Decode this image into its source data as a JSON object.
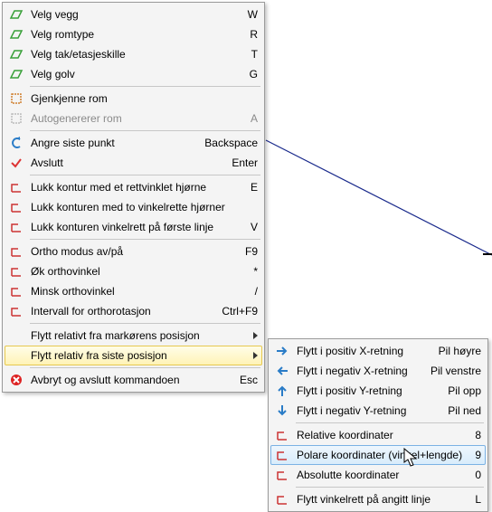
{
  "main_menu": {
    "items": [
      {
        "id": "velg-vegg",
        "label": "Velg vegg",
        "shortcut": "W",
        "icon": "wall",
        "interactable": true
      },
      {
        "id": "velg-romtype",
        "label": "Velg romtype",
        "shortcut": "R",
        "icon": "roomtype",
        "interactable": true
      },
      {
        "id": "velg-tak",
        "label": "Velg tak/etasjeskille",
        "shortcut": "T",
        "icon": "ceiling",
        "interactable": true
      },
      {
        "id": "velg-golv",
        "label": "Velg golv",
        "shortcut": "G",
        "icon": "floor",
        "interactable": true
      },
      {
        "sep": true
      },
      {
        "id": "gjenkjenne-rom",
        "label": "Gjenkjenne rom",
        "shortcut": "",
        "icon": "recognize",
        "interactable": true
      },
      {
        "id": "autogen-rom",
        "label": "Autogenererer rom",
        "shortcut": "A",
        "icon": "autogen",
        "interactable": false,
        "disabled": true
      },
      {
        "sep": true
      },
      {
        "id": "angre-punkt",
        "label": "Angre siste punkt",
        "shortcut": "Backspace",
        "icon": "undo",
        "interactable": true
      },
      {
        "id": "avslutt",
        "label": "Avslutt",
        "shortcut": "Enter",
        "icon": "finish",
        "interactable": true
      },
      {
        "sep": true
      },
      {
        "id": "lukk-rett",
        "label": "Lukk kontur med et rettvinklet hjørne",
        "shortcut": "E",
        "icon": "close-right",
        "interactable": true
      },
      {
        "id": "lukk-to",
        "label": "Lukk konturen med to vinkelrette hjørner",
        "shortcut": "",
        "icon": "close-two",
        "interactable": true
      },
      {
        "id": "lukk-forste",
        "label": "Lukk konturen vinkelrett på første linje",
        "shortcut": "V",
        "icon": "close-first",
        "interactable": true
      },
      {
        "sep": true
      },
      {
        "id": "ortho",
        "label": "Ortho modus av/på",
        "shortcut": "F9",
        "icon": "ortho",
        "interactable": true
      },
      {
        "id": "ok-ortho",
        "label": "Øk orthovinkel",
        "shortcut": "*",
        "icon": "inc-angle",
        "interactable": true
      },
      {
        "id": "minsk-ortho",
        "label": "Minsk orthovinkel",
        "shortcut": "/",
        "icon": "dec-angle",
        "interactable": true
      },
      {
        "id": "intervall",
        "label": "Intervall for orthorotasjon",
        "shortcut": "Ctrl+F9",
        "icon": "interval",
        "interactable": true
      },
      {
        "sep": true
      },
      {
        "id": "flytt-markor",
        "label": "Flytt relativt fra markørens posisjon",
        "shortcut": "",
        "icon": "",
        "submenu": true,
        "interactable": true
      },
      {
        "id": "flytt-siste",
        "label": "Flytt relativ fra siste posisjon",
        "shortcut": "",
        "icon": "",
        "submenu": true,
        "interactable": true,
        "highlight": "main"
      },
      {
        "sep": true
      },
      {
        "id": "avbryt",
        "label": "Avbryt og avslutt kommandoen",
        "shortcut": "Esc",
        "icon": "cancel",
        "interactable": true
      }
    ]
  },
  "sub_menu": {
    "items": [
      {
        "id": "pos-x",
        "label": "Flytt i positiv X-retning",
        "shortcut": "Pil høyre",
        "icon": "arrow-right",
        "interactable": true
      },
      {
        "id": "neg-x",
        "label": "Flytt i negativ X-retning",
        "shortcut": "Pil venstre",
        "icon": "arrow-left",
        "interactable": true
      },
      {
        "id": "pos-y",
        "label": "Flytt i positiv Y-retning",
        "shortcut": "Pil opp",
        "icon": "arrow-up",
        "interactable": true
      },
      {
        "id": "neg-y",
        "label": "Flytt i negativ Y-retning",
        "shortcut": "Pil ned",
        "icon": "arrow-down",
        "interactable": true
      },
      {
        "sep": true
      },
      {
        "id": "rel-koord",
        "label": "Relative koordinater",
        "shortcut": "8",
        "icon": "rel",
        "interactable": true
      },
      {
        "id": "polar-koord",
        "label": "Polare koordinater (vinkel+lengde)",
        "shortcut": "9",
        "icon": "polar",
        "interactable": true,
        "highlight": "sub"
      },
      {
        "id": "abs-koord",
        "label": "Absolutte koordinater",
        "shortcut": "0",
        "icon": "abs",
        "interactable": true
      },
      {
        "sep": true
      },
      {
        "id": "vinkelrett",
        "label": "Flytt vinkelrett på angitt linje",
        "shortcut": "L",
        "icon": "perp",
        "interactable": true
      }
    ]
  },
  "icons": {
    "wall": "#3aa03a",
    "roomtype": "#3aa03a",
    "ceiling": "#3aa03a",
    "floor": "#3aa03a",
    "recognize": "#d08030",
    "autogen": "#bcbcbc",
    "undo": "#2a7cc7",
    "finish": "#d33",
    "close-right": "#c33",
    "close-two": "#c33",
    "close-first": "#c33",
    "ortho": "#c33",
    "inc-angle": "#c33",
    "dec-angle": "#c33",
    "interval": "#c33",
    "cancel": "#d22",
    "arrow-right": "#2a7cc7",
    "arrow-left": "#2a7cc7",
    "arrow-up": "#2a7cc7",
    "arrow-down": "#2a7cc7",
    "rel": "#c33",
    "polar": "#c33",
    "abs": "#c33",
    "perp": "#c33"
  }
}
